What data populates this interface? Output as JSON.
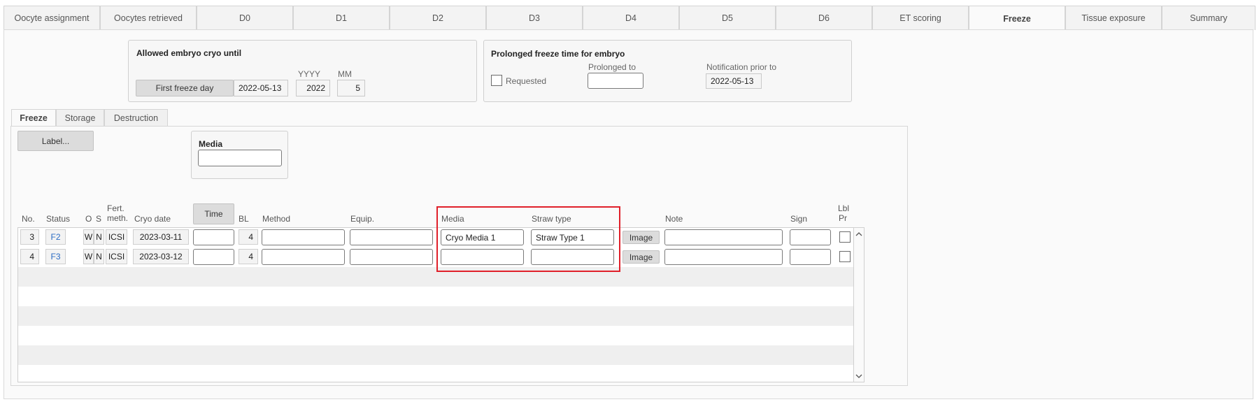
{
  "top_tabs": [
    {
      "label": "Oocyte assignment"
    },
    {
      "label": "Oocytes retrieved"
    },
    {
      "label": "D0"
    },
    {
      "label": "D1"
    },
    {
      "label": "D2"
    },
    {
      "label": "D3"
    },
    {
      "label": "D4"
    },
    {
      "label": "D5"
    },
    {
      "label": "D6"
    },
    {
      "label": "ET scoring"
    },
    {
      "label": "Freeze",
      "active": true
    },
    {
      "label": "Tissue exposure"
    },
    {
      "label": "Summary"
    }
  ],
  "cryo_until": {
    "title": "Allowed embryo cryo until",
    "yyyy_label": "YYYY",
    "mm_label": "MM",
    "first_freeze_button": "First freeze day",
    "date_value": "2022-05-13",
    "yyyy_value": "2022",
    "mm_value": "5"
  },
  "prolonged": {
    "title": "Prolonged freeze time for embryo",
    "requested_label": "Requested",
    "requested_checked": false,
    "prolonged_to_label": "Prolonged to",
    "prolonged_to_value": "",
    "notification_label": "Notification prior to",
    "notification_value": "2022-05-13"
  },
  "inner_tabs": [
    {
      "label": "Freeze",
      "active": true
    },
    {
      "label": "Storage"
    },
    {
      "label": "Destruction"
    }
  ],
  "label_button": "Label...",
  "media_box": {
    "title": "Media",
    "value": ""
  },
  "table": {
    "headers": {
      "no": "No.",
      "status": "Status",
      "o": "O",
      "s": "S",
      "fert_line1": "Fert.",
      "fert_line2": "meth.",
      "cryo_date": "Cryo date",
      "time_button": "Time",
      "bl": "BL",
      "method": "Method",
      "equip": "Equip.",
      "media": "Media",
      "straw_type": "Straw type",
      "note": "Note",
      "sign": "Sign",
      "lbl_line1": "Lbl",
      "lbl_line2": "Pr"
    },
    "rows": [
      {
        "no": "3",
        "status": "F2",
        "o": "W",
        "s": "N",
        "fert": "ICSI",
        "cryo_date": "2023-03-11",
        "time": "",
        "bl": "4",
        "method": "",
        "equip": "",
        "media": "Cryo Media 1",
        "straw_type": "Straw Type 1",
        "image_button": "Image",
        "note": "",
        "sign": "",
        "lbl_pr": false
      },
      {
        "no": "4",
        "status": "F3",
        "o": "W",
        "s": "N",
        "fert": "ICSI",
        "cryo_date": "2023-03-12",
        "time": "",
        "bl": "4",
        "method": "",
        "equip": "",
        "media": "",
        "straw_type": "",
        "image_button": "Image",
        "note": "",
        "sign": "",
        "lbl_pr": false
      }
    ]
  },
  "colors": {
    "highlight": "#e0202a",
    "status_link": "#2b6cc4"
  },
  "icons": {
    "scroll_up": "chevron-up-icon",
    "scroll_down": "chevron-down-icon"
  }
}
